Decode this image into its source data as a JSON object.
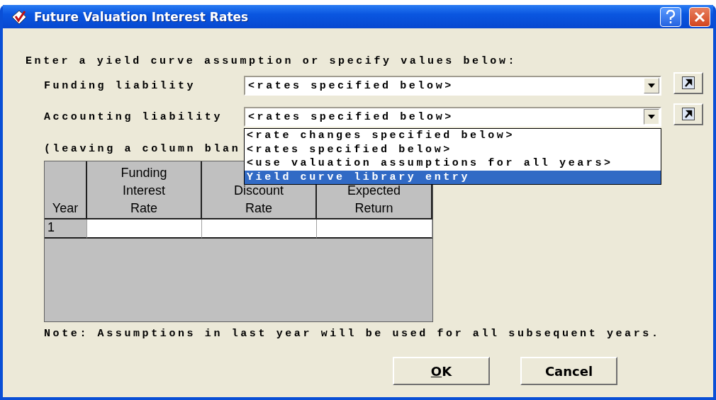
{
  "window": {
    "title": "Future Valuation Interest Rates"
  },
  "instruction": "Enter a yield curve assumption or specify values below:",
  "fields": [
    {
      "label": "Funding liability",
      "value": "<rates specified below>",
      "open": false
    },
    {
      "label": "Accounting liability",
      "value": "<rates specified below>",
      "open": true
    }
  ],
  "dropdown_options": [
    {
      "label": "<rate changes specified below>",
      "selected": false
    },
    {
      "label": "<rates specified below>",
      "selected": false
    },
    {
      "label": "<use valuation assumptions for all years>",
      "selected": false
    },
    {
      "label": "Yield curve library entry",
      "selected": true
    }
  ],
  "hint": "(leaving a column blan",
  "table": {
    "columns": [
      {
        "lines": [
          "Year"
        ]
      },
      {
        "lines": [
          "Funding",
          "Interest",
          "Rate"
        ]
      },
      {
        "lines": [
          "Discount",
          "Rate"
        ]
      },
      {
        "lines": [
          "Expected",
          "Return"
        ]
      }
    ],
    "rows": [
      [
        "1",
        "",
        "",
        ""
      ]
    ]
  },
  "note": "Note: Assumptions in last year will be used for all subsequent years.",
  "buttons": [
    {
      "label": "OK",
      "underline_first": true
    },
    {
      "label": "Cancel",
      "underline_first": false
    }
  ]
}
